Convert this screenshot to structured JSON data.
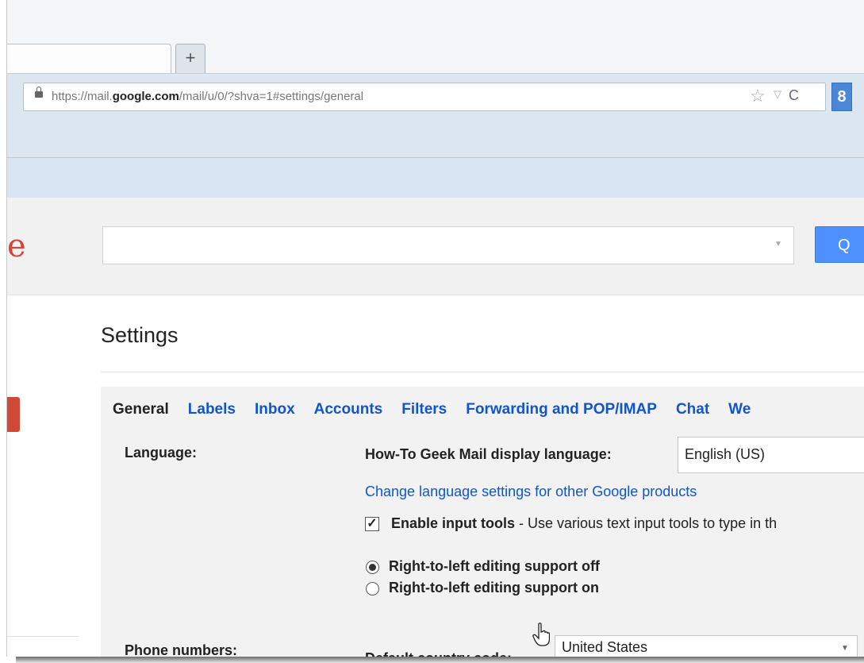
{
  "browser": {
    "new_tab_glyph": "+",
    "url_prefix": "https://mail.",
    "url_domain": "google.com",
    "url_path": "/mail/u/0/?shva=1#settings/general",
    "toolbar_badge": "8"
  },
  "header": {
    "logo_fragment": "e",
    "search_placeholder": "",
    "search_button": "Q"
  },
  "settings": {
    "title": "Settings",
    "tabs": [
      "General",
      "Labels",
      "Inbox",
      "Accounts",
      "Filters",
      "Forwarding and POP/IMAP",
      "Chat",
      "We"
    ],
    "language": {
      "label": "Language:",
      "display_label": "How-To Geek Mail display language:",
      "display_value": "English (US)",
      "change_link": "Change language settings for other Google products",
      "input_tools_bold": "Enable input tools",
      "input_tools_desc": " - Use various text input tools to type in th",
      "rtl_off": "Right-to-left editing support off",
      "rtl_on": "Right-to-left editing support on"
    },
    "phone": {
      "label": "Phone numbers:",
      "default_label": "Default country code:",
      "default_value": "United States"
    }
  }
}
